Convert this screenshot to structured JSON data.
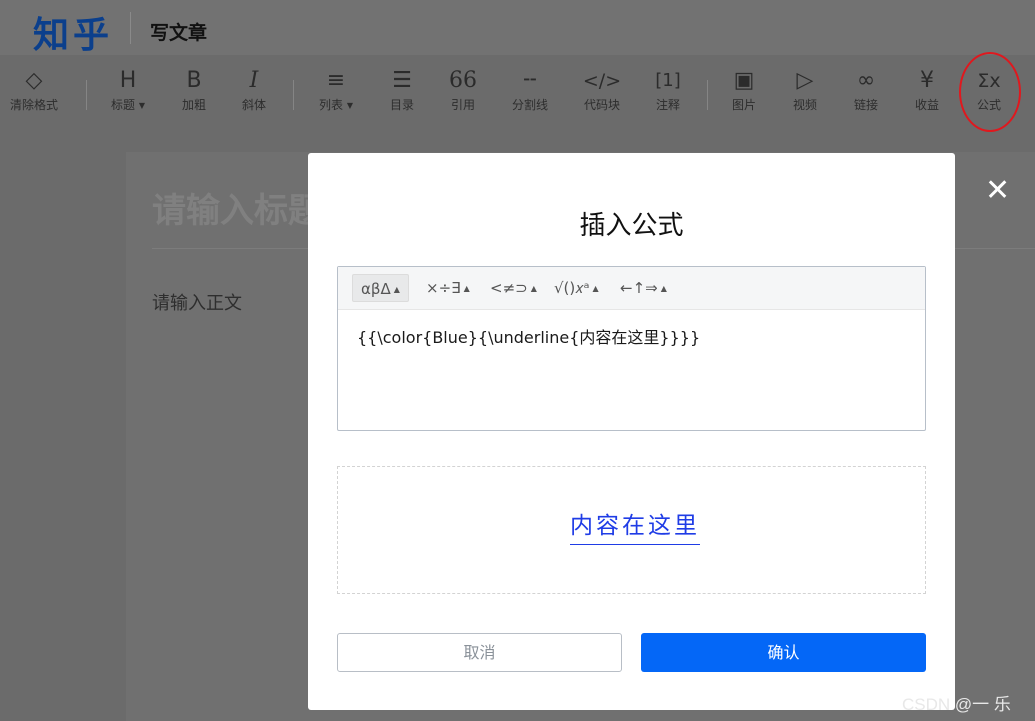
{
  "header": {
    "logo": "知乎",
    "page_label": "写文章"
  },
  "toolbar": {
    "items": [
      {
        "icon": "◇",
        "label": "清除格式",
        "name": "clear-format"
      },
      {
        "icon": "H",
        "label": "标题",
        "name": "heading",
        "dropdown": true
      },
      {
        "icon": "B",
        "label": "加粗",
        "name": "bold"
      },
      {
        "icon": "I",
        "label": "斜体",
        "name": "italic"
      },
      {
        "icon": "≡",
        "label": "列表",
        "name": "list",
        "dropdown": true
      },
      {
        "icon": "☰",
        "label": "目录",
        "name": "toc"
      },
      {
        "icon": "66",
        "label": "引用",
        "name": "quote"
      },
      {
        "icon": "╌",
        "label": "分割线",
        "name": "divider"
      },
      {
        "icon": "</>",
        "label": "代码块",
        "name": "code-block"
      },
      {
        "icon": "[1]",
        "label": "注释",
        "name": "footnote"
      },
      {
        "icon": "▣",
        "label": "图片",
        "name": "image"
      },
      {
        "icon": "▷",
        "label": "视频",
        "name": "video"
      },
      {
        "icon": "∞",
        "label": "链接",
        "name": "link"
      },
      {
        "icon": "¥",
        "label": "收益",
        "name": "income"
      },
      {
        "icon": "Σx",
        "label": "公式",
        "name": "formula"
      }
    ]
  },
  "editor": {
    "title_placeholder": "请输入标题",
    "body_placeholder": "请输入正文"
  },
  "modal": {
    "title": "插入公式",
    "symbol_groups": [
      "αβΔ",
      "×÷∃",
      "<≠⊃",
      "√()𝑥ᵃ",
      "←↑⇒"
    ],
    "formula_text": "{{\\color{Blue}{\\underline{内容在这里}}}}",
    "preview_text": "内容在这里",
    "cancel_label": "取消",
    "confirm_label": "确认",
    "close_icon": "✕"
  },
  "colors": {
    "accent": "#0467f7",
    "preview": "#1f3ce6",
    "highlight": "#e0181e"
  },
  "watermark": "CSDN @一 乐"
}
